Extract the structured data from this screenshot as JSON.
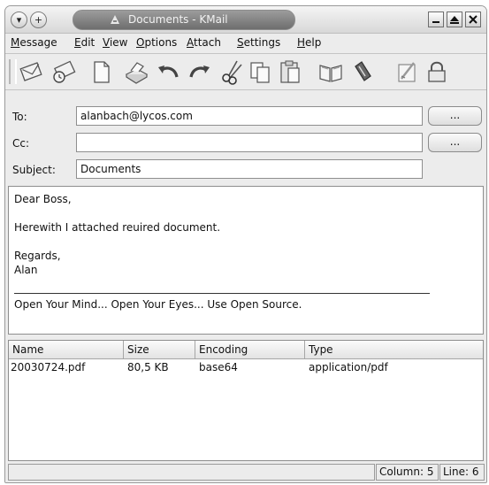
{
  "window": {
    "title": "Documents - KMail"
  },
  "menubar": {
    "items": [
      "Message",
      "Edit",
      "View",
      "Options",
      "Attach",
      "Settings",
      "Help"
    ]
  },
  "toolbar": {
    "icons": [
      "send-icon",
      "queue-icon",
      "new-icon",
      "print-icon",
      "undo-icon",
      "redo-icon",
      "cut-icon",
      "copy-icon",
      "paste-icon",
      "address-book-icon",
      "attach-icon",
      "sign-icon",
      "encrypt-icon"
    ]
  },
  "header": {
    "to_label": "To:",
    "to_value": "alanbach@lycos.com",
    "cc_label": "Cc:",
    "cc_value": "",
    "subject_label": "Subject:",
    "subject_value": "Documents",
    "browse_label": "..."
  },
  "body": {
    "greeting": "Dear Boss,",
    "line1": "Herewith I attached reuired document.",
    "closing": "Regards,",
    "name": "Alan",
    "signature": "Open Your Mind... Open Your Eyes... Use Open Source."
  },
  "attachments": {
    "columns": [
      "Name",
      "Size",
      "Encoding",
      "Type"
    ],
    "rows": [
      {
        "name": "20030724.pdf",
        "size": "80,5 KB",
        "encoding": "base64",
        "type": "application/pdf"
      }
    ]
  },
  "status": {
    "message": "",
    "column": "Column: 5",
    "line": "Line: 6"
  }
}
